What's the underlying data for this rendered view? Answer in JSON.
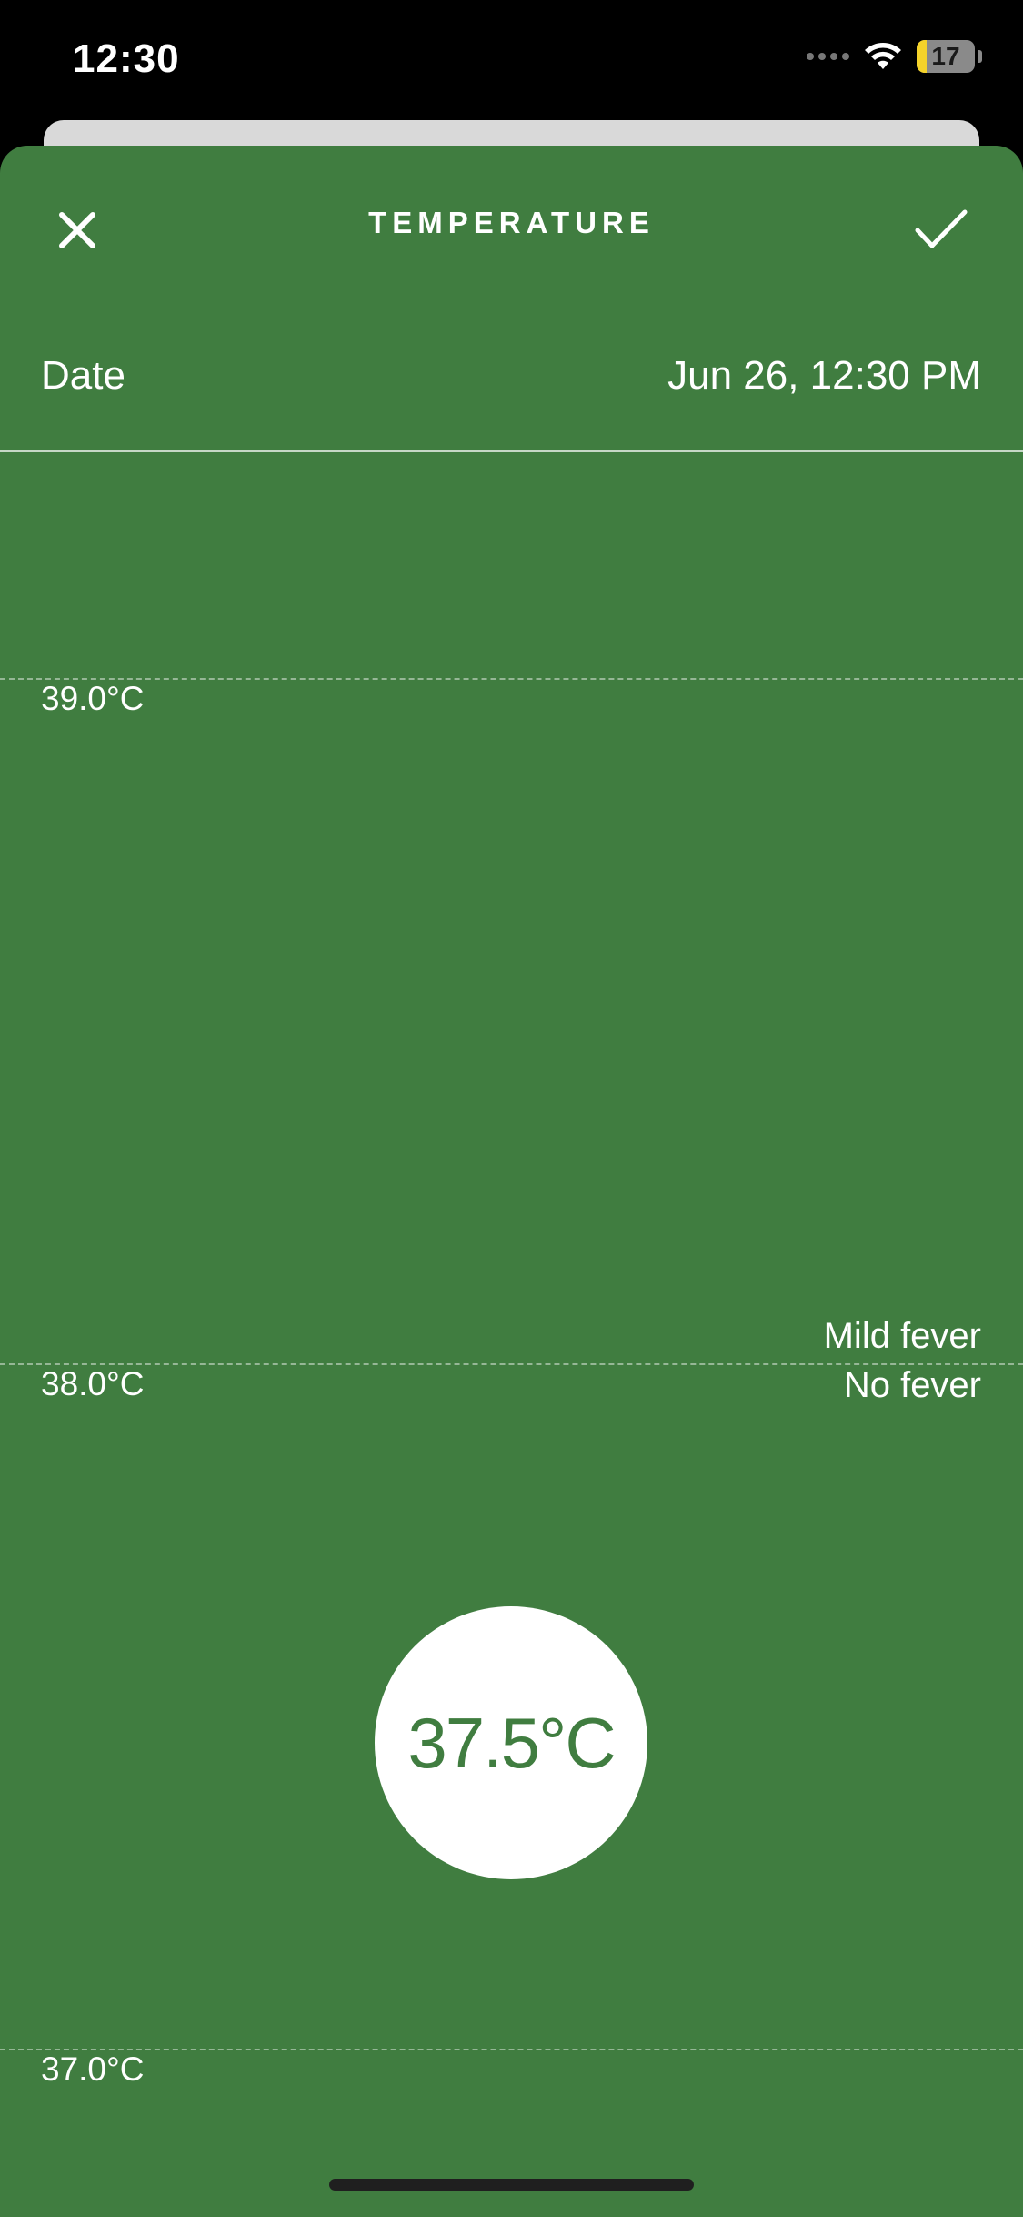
{
  "status_bar": {
    "time": "12:30",
    "battery_level": "17",
    "icons": [
      "cellular-signal-icon",
      "wifi-icon",
      "battery-icon"
    ]
  },
  "header": {
    "title": "TEMPERATURE",
    "close_icon": "close-icon",
    "confirm_icon": "checkmark-icon"
  },
  "date_row": {
    "label": "Date",
    "value": "Jun 26, 12:30 PM"
  },
  "scale": {
    "ticks": [
      {
        "label": "39.0°C",
        "value": 39.0
      },
      {
        "label": "38.0°C",
        "value": 38.0
      },
      {
        "label": "37.0°C",
        "value": 37.0
      }
    ],
    "zone_above": "Mild fever",
    "zone_below": "No fever",
    "fever_threshold": 38.0
  },
  "selected": {
    "value": 37.5,
    "display": "37.5°C"
  },
  "colors": {
    "background": "#407d40",
    "knob": "#ffffff",
    "battery_fill": "#f5d32a"
  }
}
